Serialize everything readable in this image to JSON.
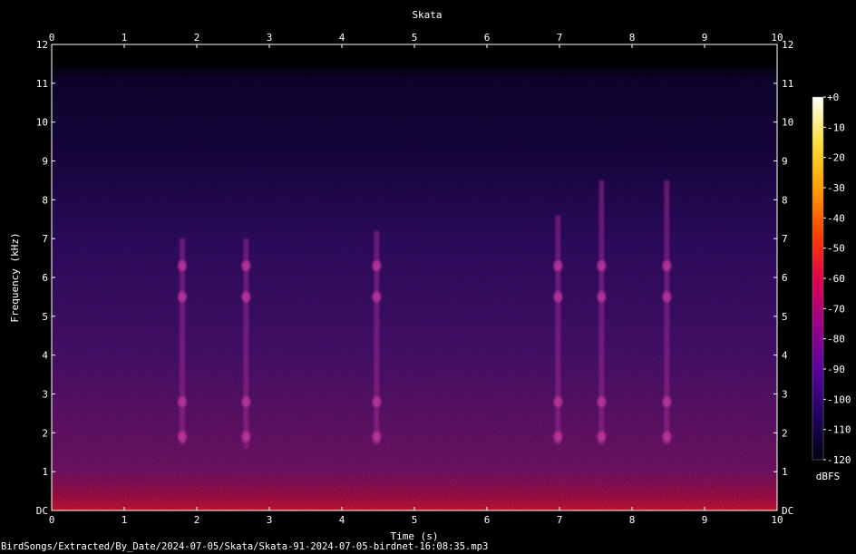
{
  "chart_data": {
    "type": "heatmap",
    "title": "Skata",
    "xlabel": "Time (s)",
    "ylabel": "Frequency (kHz)",
    "xlim": [
      0,
      10
    ],
    "ylim": [
      0,
      12
    ],
    "x_ticks": [
      "0",
      "1",
      "2",
      "3",
      "4",
      "5",
      "6",
      "7",
      "8",
      "9",
      "10"
    ],
    "y_ticks": [
      "DC",
      "1",
      "2",
      "3",
      "4",
      "5",
      "6",
      "7",
      "8",
      "9",
      "10",
      "11",
      "12"
    ],
    "colorbar": {
      "label": "dBFS",
      "range": [
        -120,
        0
      ],
      "ticks": [
        "+0",
        "-10",
        "-20",
        "-30",
        "-40",
        "-50",
        "-60",
        "-70",
        "-80",
        "-90",
        "-100",
        "-110",
        "-120"
      ],
      "colors": [
        "#ffffff",
        "#ffd21a",
        "#ff7a00",
        "#ff1a1a",
        "#c0005a",
        "#7a0090",
        "#2a0070",
        "#000020"
      ]
    },
    "calls": [
      {
        "t": 1.8,
        "f_low": 1.7,
        "f_high": 7.0
      },
      {
        "t": 2.68,
        "f_low": 1.6,
        "f_high": 7.0
      },
      {
        "t": 4.48,
        "f_low": 1.7,
        "f_high": 7.2
      },
      {
        "t": 6.98,
        "f_low": 1.7,
        "f_high": 7.6
      },
      {
        "t": 7.58,
        "f_low": 1.7,
        "f_high": 8.5
      },
      {
        "t": 8.48,
        "f_low": 1.7,
        "f_high": 8.5
      }
    ]
  },
  "footer_path": "BirdSongs/Extracted/By_Date/2024-07-05/Skata/Skata-91-2024-07-05-birdnet-16:08:35.mp3"
}
